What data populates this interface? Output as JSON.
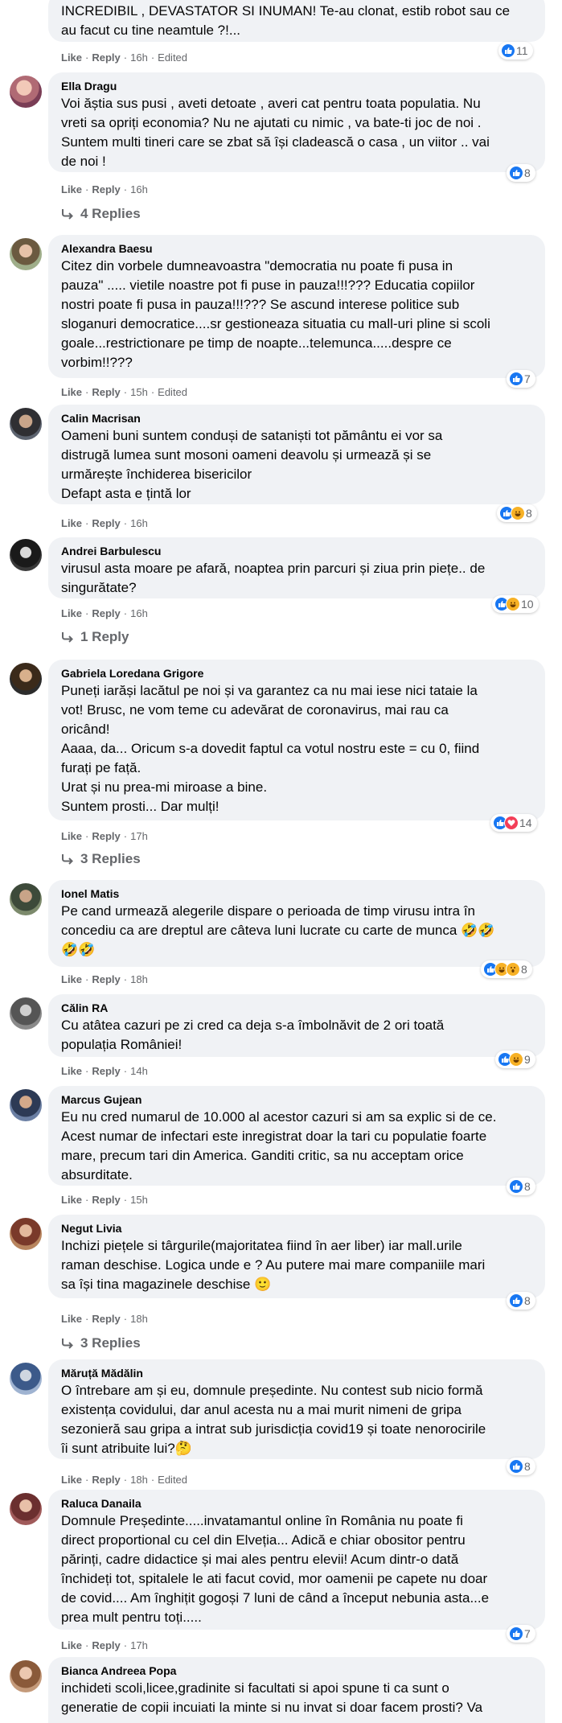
{
  "comments": [
    {
      "author": "",
      "text": "INCREDIBIL , DEVASTATOR SI INUMAN! Te-au clonat, estib robot sau ce\nau facut cu tine neamtule ?!...",
      "like": "Like",
      "reply": "Reply",
      "time": "16h",
      "edited": "Edited",
      "reactions": [
        "like"
      ],
      "reaction_count": "11"
    },
    {
      "author": "Ella Dragu",
      "text": "Voi ăștia sus pusi , aveti detoate , averi cat pentru toata populatia. Nu\nvreti sa opriți economia? Nu ne ajutati cu nimic , va bate-ti joc de noi .\nSuntem multi tineri care se zbat să își cladească o casa , un viitor .. vai\nde noi !",
      "like": "Like",
      "reply": "Reply",
      "time": "16h",
      "reactions": [
        "like"
      ],
      "reaction_count": "8",
      "replies": "4 Replies"
    },
    {
      "author": "Alexandra Baesu",
      "text": "Citez din vorbele dumneavoastra \"democratia nu poate fi pusa in\npauza\" ..... vietile noastre pot fi puse in pauza!!!??? Educatia copiilor\nnostri poate fi pusa in pauza!!!??? Se ascund interese politice sub\nsloganuri democratice....sr gestioneaza situatia cu mall-uri pline si scoli\ngoale...restrictionare pe timp de noapte...telemunca.....despre ce\nvorbim!!???",
      "like": "Like",
      "reply": "Reply",
      "time": "15h",
      "edited": "Edited",
      "reactions": [
        "like"
      ],
      "reaction_count": "7"
    },
    {
      "author": "Calin Macrisan",
      "text": "Oameni buni suntem conduși de sataniști tot pământu ei vor sa\ndistrugă lumea sunt mosoni oameni deavolu și urmează și se\nurmărește închiderea bisericilor\nDefapt asta e țintă lor",
      "like": "Like",
      "reply": "Reply",
      "time": "16h",
      "reactions": [
        "like",
        "haha"
      ],
      "reaction_count": "8"
    },
    {
      "author": "Andrei Barbulescu",
      "text": "virusul asta moare pe afară, noaptea prin parcuri și ziua prin piețe.. de\nsingurătate?",
      "like": "Like",
      "reply": "Reply",
      "time": "16h",
      "reactions": [
        "like",
        "haha"
      ],
      "reaction_count": "10",
      "replies": "1 Reply"
    },
    {
      "author": "Gabriela Loredana Grigore",
      "text": "Puneți iarăși lacătul pe noi și va garantez ca nu mai iese nici tataie la\nvot! Brusc, ne vom teme cu adevărat de coronavirus, mai rau ca\noricând!\nAaaa, da... Oricum s-a dovedit faptul ca votul nostru este = cu 0, fiind\nfurați pe față.\nUrat și nu prea-mi miroase a bine.\nSuntem prosti... Dar mulți!",
      "like": "Like",
      "reply": "Reply",
      "time": "17h",
      "reactions": [
        "like",
        "love"
      ],
      "reaction_count": "14",
      "replies": "3 Replies"
    },
    {
      "author": "Ionel Matis",
      "text": "Pe cand urmează alegerile dispare o perioada de timp virusu intra în\nconcediu ca are dreptul are câteva luni lucrate cu carte de munca",
      "emoji_inline": "🤣🤣",
      "emoji_line2": "🤣🤣",
      "like": "Like",
      "reply": "Reply",
      "time": "18h",
      "reactions": [
        "like",
        "haha",
        "wow"
      ],
      "reaction_count": "8"
    },
    {
      "author": "Călin RA",
      "text": "Cu atâtea cazuri pe zi cred ca deja s-a îmbolnăvit de 2 ori toată\npopulația României!",
      "like": "Like",
      "reply": "Reply",
      "time": "14h",
      "reactions": [
        "like",
        "haha"
      ],
      "reaction_count": "9"
    },
    {
      "author": "Marcus Gujean",
      "text": "Eu nu cred numarul de 10.000 al acestor cazuri si am sa explic si de ce.\nAcest numar de infectari este inregistrat doar la tari cu populatie foarte\nmare, precum tari din America. Ganditi critic, sa nu acceptam orice\nabsurditate.",
      "like": "Like",
      "reply": "Reply",
      "time": "15h",
      "reactions": [
        "like"
      ],
      "reaction_count": "8"
    },
    {
      "author": "Negut Livia",
      "text": "Inchizi piețele si târgurile(majoritatea fiind în aer liber) iar mall.urile\nraman deschise. Logica unde e ? Au putere mai mare companiile mari\nsa își tina magazinele deschise",
      "emoji_end": "🙂",
      "like": "Like",
      "reply": "Reply",
      "time": "18h",
      "reactions": [
        "like"
      ],
      "reaction_count": "8",
      "replies": "3 Replies"
    },
    {
      "author": "Măruță Mădălin",
      "text": "O întrebare am și eu, domnule președinte. Nu contest sub nicio formă\nexistența covidului, dar anul acesta nu a mai murit nimeni de gripa\nsezonieră sau gripa a intrat sub jurisdicția covid19 și toate nenorocirile\nîi sunt atribuite lui?",
      "emoji_end": "🤔",
      "like": "Like",
      "reply": "Reply",
      "time": "18h",
      "edited": "Edited",
      "reactions": [
        "like"
      ],
      "reaction_count": "8"
    },
    {
      "author": "Raluca Danaila",
      "text": "Domnule Președinte.....invatamantul online în România nu poate fi\ndirect proportional cu cel din Elveția... Adică e chiar obositor pentru\npărinți, cadre didactice și mai ales pentru elevii! Acum dintr-o dată\nînchideți tot, spitalele le ati facut covid, mor oamenii pe capete nu doar\nde covid.... Am înghițit gogoși 7 luni de când a început nebunia asta...e\nprea mult pentru toți.....",
      "like": "Like",
      "reply": "Reply",
      "time": "17h",
      "reactions": [
        "like"
      ],
      "reaction_count": "7"
    },
    {
      "author": "Bianca Andreea Popa",
      "text": "inchideti scoli,licee,gradinite si facultati si apoi spune ti ca sunt o\ngeneratie de copii incuiati la minte si nu invat si doar facem prosti? Va"
    }
  ],
  "colors": {
    "bubble": "#f0f2f5",
    "meta": "#65676b",
    "like_blue": "#1877f2",
    "haha_yellow": "#f7b125",
    "love_red": "#f33e58"
  }
}
